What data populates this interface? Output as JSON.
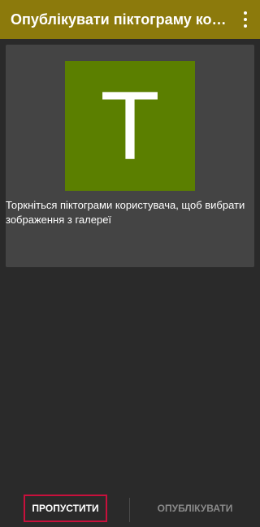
{
  "app_bar": {
    "title": "Опублікувати піктограму користу...",
    "background": "#8c7a0c",
    "overflow_icon": "more-vert-icon"
  },
  "card": {
    "avatar_letter": "T",
    "avatar_color": "#5b7f00",
    "hint": "Торкніться піктограми користувача, щоб вибрати зображення з галереї"
  },
  "footer": {
    "skip_label": "ПРОПУСТИТИ",
    "publish_label": "ОПУБЛІКУВАТИ",
    "focus_color": "#c8103c"
  }
}
